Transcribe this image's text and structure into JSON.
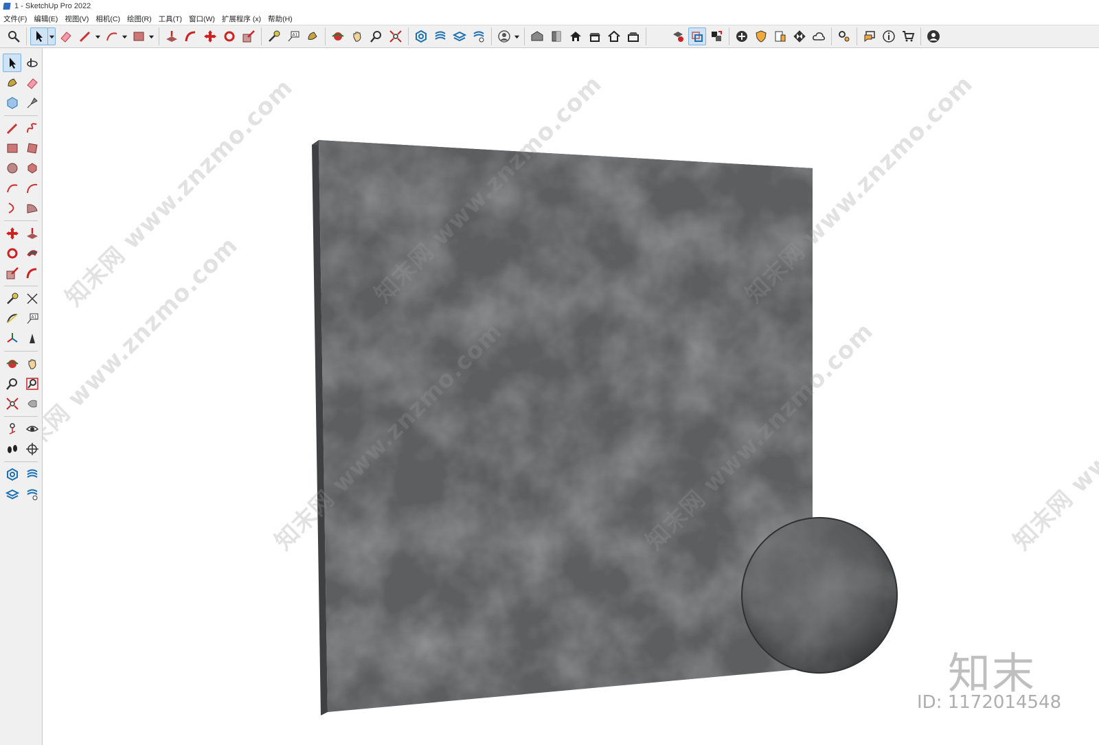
{
  "window": {
    "title": "1 - SketchUp Pro 2022"
  },
  "menu": [
    "文件(F)",
    "编辑(E)",
    "视图(V)",
    "相机(C)",
    "绘图(R)",
    "工具(T)",
    "窗口(W)",
    "扩展程序 (x)",
    "帮助(H)"
  ],
  "watermark": {
    "text": "知末网 www.znzmo.com",
    "brand": "知末",
    "id": "ID: 1172014548"
  },
  "colors": {
    "toolbar_bg": "#f0f0f0",
    "active_tool": "#cfe3f7",
    "panel_face": "#5d5e60",
    "panel_side": "#3f4042",
    "sphere": "#58595b"
  },
  "icons": {
    "top_toolbar": [
      "zoom-icon",
      "select-icon",
      "eraser-icon",
      "pencil-icon",
      "arc-icon",
      "rectangle-icon",
      "pushpull-icon",
      "followme-icon",
      "move-icon",
      "rotate-icon",
      "scale-icon",
      "tape-icon",
      "text-icon",
      "paint-icon",
      "orbit-icon",
      "pan-icon",
      "zoom-window-icon",
      "zoom-extents-icon",
      "sandbox-icon",
      "layers-icon",
      "styles-icon",
      "user-icon",
      "warehouse-icon",
      "components-icon",
      "house-icon",
      "house-open-icon",
      "house-outline-icon",
      "house-box-icon",
      "solid-tools-icon",
      "section-icon",
      "scenes-icon",
      "add-icon",
      "shield-icon",
      "report-icon",
      "checker-icon",
      "cloud-icon",
      "settings-icon",
      "message-icon",
      "info-icon",
      "cart-icon",
      "account-icon"
    ]
  }
}
